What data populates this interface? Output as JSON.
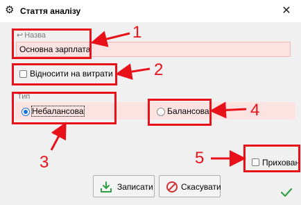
{
  "window": {
    "title": "Стаття аналізу",
    "settings_icon": "gear-icon",
    "close_icon": "close-icon"
  },
  "form": {
    "name_label": "Назва",
    "name_value": "Основна зарплата",
    "expense_checkbox_label": "Відносити на витрати",
    "expense_checked": false,
    "type_group_label": "Тип",
    "type_options": [
      {
        "label": "Небалансова",
        "checked": true
      },
      {
        "label": "Балансова",
        "checked": false
      }
    ],
    "hidden_checkbox_label": "Прихован",
    "hidden_checked": false
  },
  "buttons": {
    "save_label": "Записати",
    "cancel_label": "Скасувати"
  },
  "annotations": {
    "numbers": [
      "1",
      "2",
      "3",
      "4",
      "5"
    ],
    "color": "#e8111a"
  },
  "colors": {
    "required_field_bg": "#fde2e2",
    "radio_accent": "#1a73d9",
    "save_icon": "#2ea043",
    "cancel_icon": "#d32f2f"
  }
}
